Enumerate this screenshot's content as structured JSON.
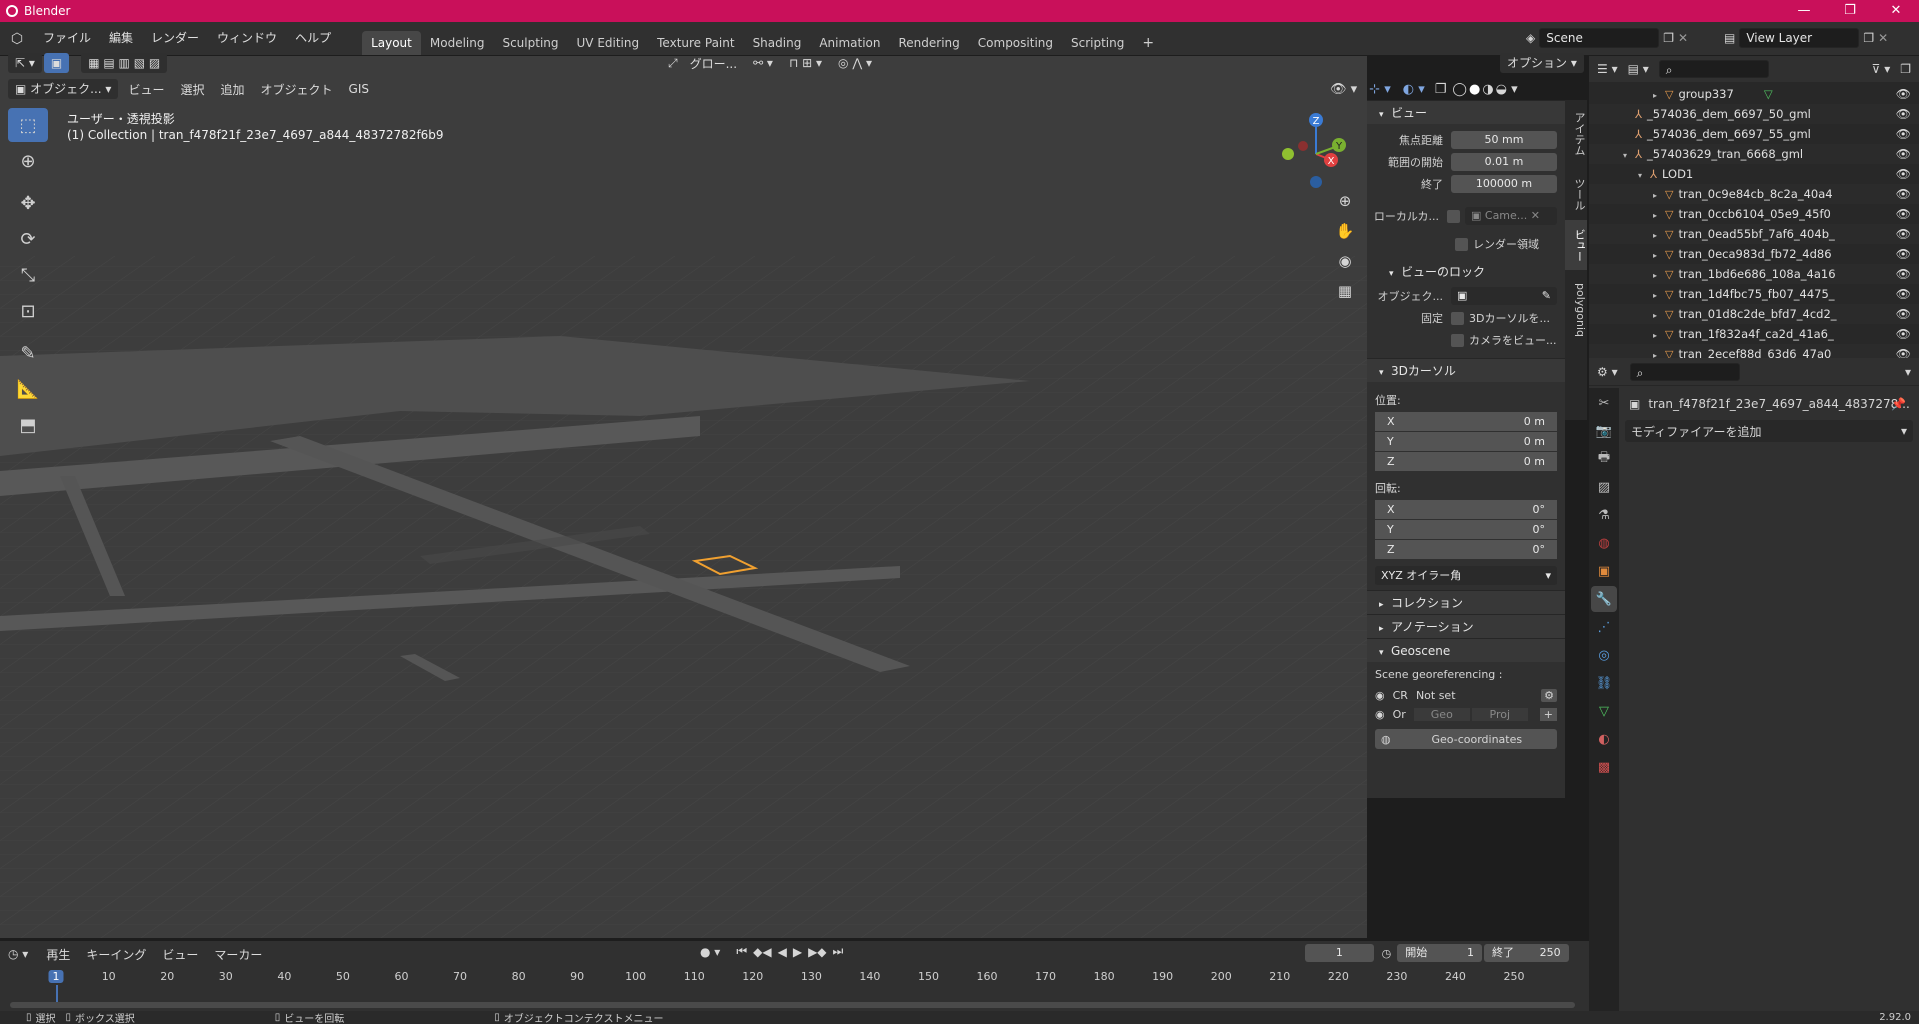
{
  "window": {
    "title": "Blender"
  },
  "menu": [
    "ファイル",
    "編集",
    "レンダー",
    "ウィンドウ",
    "ヘルプ"
  ],
  "workspaces": [
    "Layout",
    "Modeling",
    "Sculpting",
    "UV Editing",
    "Texture Paint",
    "Shading",
    "Animation",
    "Rendering",
    "Compositing",
    "Scripting"
  ],
  "active_workspace": "Layout",
  "scene": {
    "name": "Scene",
    "view_layer": "View Layer"
  },
  "viewport": {
    "mode": "オブジェク...",
    "header_menu": [
      "ビュー",
      "選択",
      "追加",
      "オブジェクト",
      "GIS"
    ],
    "transform_orient": "グロー...",
    "options_label": "オプション",
    "view_label": "ユーザー・透視投影",
    "collection_label": "(1) Collection | tran_f478f21f_23e7_4697_a844_48372782f6b9",
    "gizmo": {
      "x": "X",
      "y": "Y",
      "z": "Z"
    }
  },
  "npanel": {
    "tabs": [
      "アイテム",
      "ツール",
      "ビュー",
      "polygoniq"
    ],
    "active_tab": "ビュー",
    "view": {
      "title": "ビュー",
      "focal_label": "焦点距離",
      "focal": "50 mm",
      "clip_start_label": "範囲の開始",
      "clip_start": "0.01 m",
      "clip_end_label": "終了",
      "clip_end": "100000 m",
      "local_cam_label": "ローカルカ...",
      "local_cam": "Came...",
      "render_region": "レンダー領域",
      "lock_title": "ビューのロック",
      "lock_obj_label": "オブジェク...",
      "lock_label": "固定",
      "lock_cursor": "3Dカーソルを...",
      "lock_camera": "カメラをビュー..."
    },
    "cursor": {
      "title": "3Dカーソル",
      "location_label": "位置:",
      "loc": [
        {
          "axis": "X",
          "val": "0 m"
        },
        {
          "axis": "Y",
          "val": "0 m"
        },
        {
          "axis": "Z",
          "val": "0 m"
        }
      ],
      "rotation_label": "回転:",
      "rot": [
        {
          "axis": "X",
          "val": "0°"
        },
        {
          "axis": "Y",
          "val": "0°"
        },
        {
          "axis": "Z",
          "val": "0°"
        }
      ],
      "rot_mode": "XYZ オイラー角"
    },
    "collections": "コレクション",
    "annotations": "アノテーション",
    "geoscene": {
      "title": "Geoscene",
      "georef_label": "Scene georeferencing :",
      "crs": "CR",
      "crs_value": "Not set",
      "origin": "Or",
      "geo": "Geo",
      "proj": "Proj",
      "geo_coords": "Geo-coordinates"
    }
  },
  "outliner": [
    {
      "indent": 4,
      "type": "mesh",
      "name": "group337",
      "tri": "▸"
    },
    {
      "indent": 2,
      "type": "coll",
      "name": "_574036_dem_6697_50_gml",
      "tri": ""
    },
    {
      "indent": 2,
      "type": "coll",
      "name": "_574036_dem_6697_55_gml",
      "tri": ""
    },
    {
      "indent": 2,
      "type": "coll",
      "name": "_57403629_tran_6668_gml",
      "tri": "▾"
    },
    {
      "indent": 3,
      "type": "coll",
      "name": "LOD1",
      "tri": "▾"
    },
    {
      "indent": 4,
      "type": "mesh",
      "name": "tran_0c9e84cb_8c2a_40a4",
      "tri": "▸"
    },
    {
      "indent": 4,
      "type": "mesh",
      "name": "tran_0ccb6104_05e9_45f0",
      "tri": "▸"
    },
    {
      "indent": 4,
      "type": "mesh",
      "name": "tran_0ead55bf_7af6_404b_",
      "tri": "▸"
    },
    {
      "indent": 4,
      "type": "mesh",
      "name": "tran_0eca983d_fb72_4d86",
      "tri": "▸"
    },
    {
      "indent": 4,
      "type": "mesh",
      "name": "tran_1bd6e686_108a_4a16",
      "tri": "▸"
    },
    {
      "indent": 4,
      "type": "mesh",
      "name": "tran_1d4fbc75_fb07_4475_",
      "tri": "▸"
    },
    {
      "indent": 4,
      "type": "mesh",
      "name": "tran_01d8c2de_bfd7_4cd2_",
      "tri": "▸"
    },
    {
      "indent": 4,
      "type": "mesh",
      "name": "tran_1f832a4f_ca2d_41a6_",
      "tri": "▸"
    },
    {
      "indent": 4,
      "type": "mesh",
      "name": "tran_2ecef88d_63d6_47a0_",
      "tri": "▸"
    }
  ],
  "properties": {
    "object_name": "tran_f478f21f_23e7_4697_a844_4837278...",
    "add_modifier": "モディファイアーを追加"
  },
  "timeline": {
    "menu": [
      "再生",
      "キーイング",
      "ビュー",
      "マーカー"
    ],
    "current_frame": "1",
    "start_label": "開始",
    "start": "1",
    "end_label": "終了",
    "end": "250",
    "ticks": [
      "1",
      "10",
      "20",
      "30",
      "40",
      "50",
      "60",
      "70",
      "80",
      "90",
      "100",
      "110",
      "120",
      "130",
      "140",
      "150",
      "160",
      "170",
      "180",
      "190",
      "200",
      "210",
      "220",
      "230",
      "240",
      "250"
    ]
  },
  "status": {
    "select": "選択",
    "box_select": "ボックス選択",
    "rotate_view": "ビューを回転",
    "context_menu": "オブジェクトコンテクストメニュー",
    "version": "2.92.0"
  }
}
